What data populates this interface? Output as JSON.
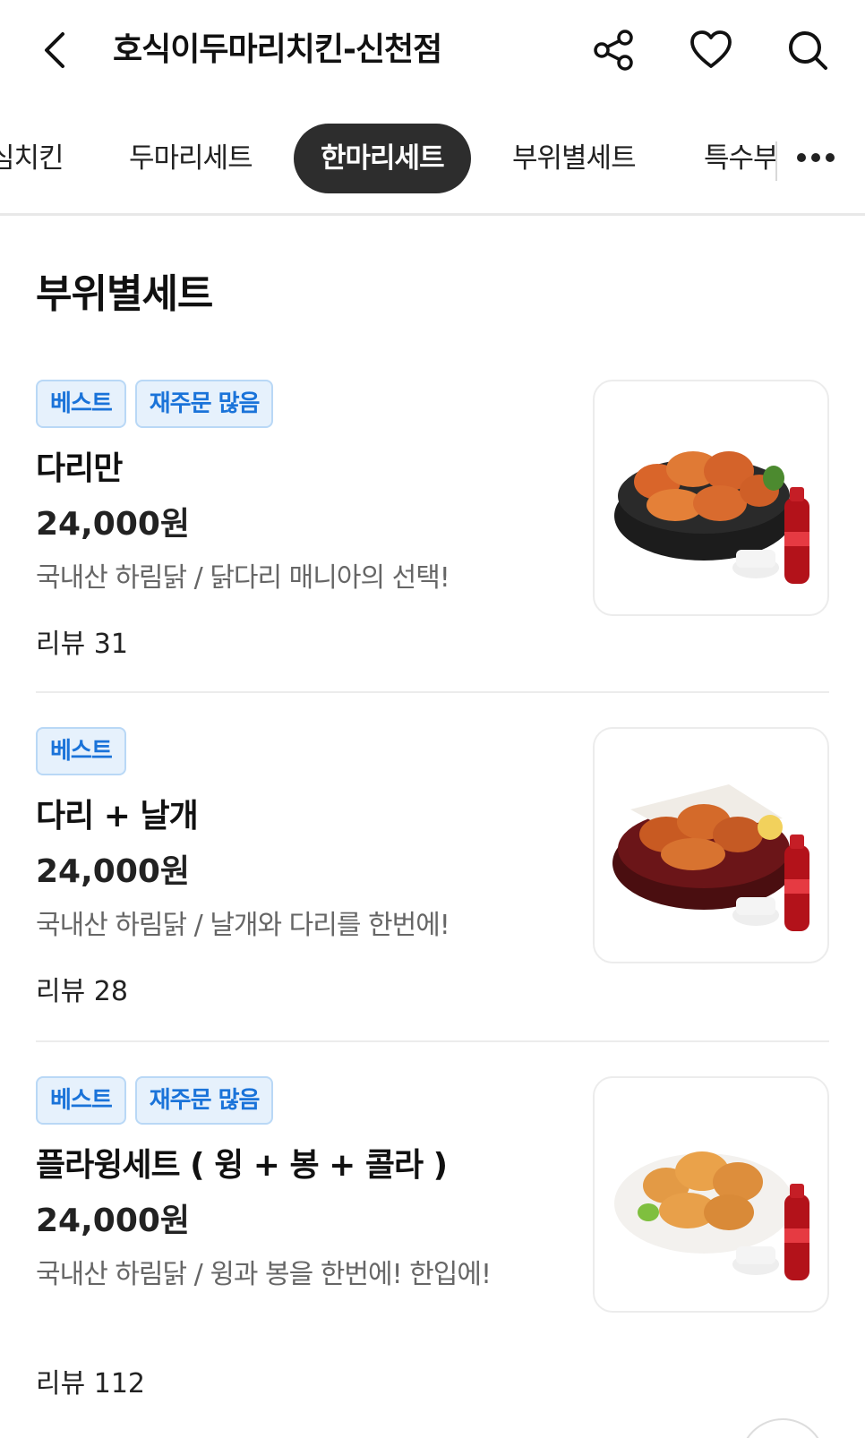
{
  "header": {
    "title": "호식이두마리치킨-신천점"
  },
  "tabs": [
    {
      "label": "심치킨",
      "active": false
    },
    {
      "label": "두마리세트",
      "active": false
    },
    {
      "label": "한마리세트",
      "active": true
    },
    {
      "label": "부위별세트",
      "active": false
    },
    {
      "label": "특수부",
      "active": false
    }
  ],
  "section": {
    "title": "부위별세트"
  },
  "items": [
    {
      "badges": [
        "베스트",
        "재주문 많음"
      ],
      "name": "다리만",
      "price": "24,000원",
      "desc": "국내산 하림닭  /  닭다리 매니아의 선택!",
      "review": "리뷰 31",
      "image": "fried-drumsticks-in-black-bowl-with-coke"
    },
    {
      "badges": [
        "베스트"
      ],
      "name": "다리 + 날개",
      "price": "24,000원",
      "desc": "국내산 하림닭  /  날개와 다리를 한번에!",
      "review": "리뷰 28",
      "image": "fried-wings-and-legs-on-wooden-plate-with-coke"
    },
    {
      "badges": [
        "베스트",
        "재주문 많음"
      ],
      "name": "플라윙세트 ( 윙 + 봉 + 콜라 )",
      "price": "24,000원",
      "desc": "국내산 하림닭  /  윙과 봉을 한번에! 한입에!",
      "review": "리뷰 112",
      "image": "fried-wings-on-white-plate-with-coke"
    }
  ],
  "colors": {
    "badge_text": "#1a73d9",
    "badge_bg": "#e6f1fc",
    "active_tab_bg": "#2d2d2d"
  },
  "icons": [
    "back-arrow-icon",
    "share-icon",
    "heart-icon",
    "search-icon",
    "more-dots-icon"
  ]
}
